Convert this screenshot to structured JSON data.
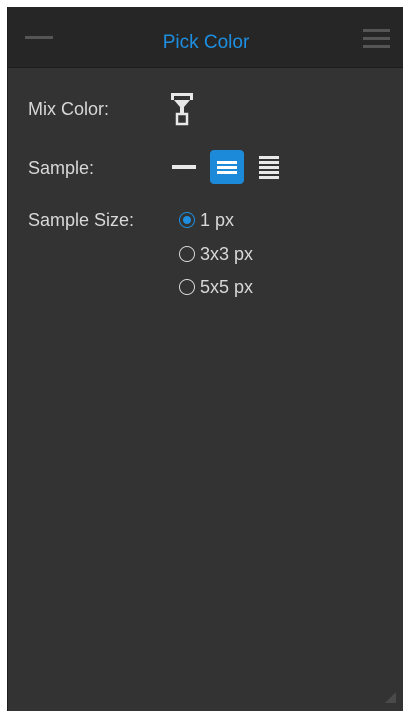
{
  "panel": {
    "title": "Pick Color",
    "minimize_icon": "minimize-dash-icon",
    "menu_icon": "hamburger-menu-icon",
    "title_color": "#1e8fe0",
    "background_color": "#333333"
  },
  "mix_color": {
    "label": "Mix Color:",
    "icon": "eyedropper-mix-icon"
  },
  "sample": {
    "label": "Sample:",
    "options": [
      {
        "icon": "single-line-icon",
        "active": false
      },
      {
        "icon": "three-lines-icon",
        "active": true
      },
      {
        "icon": "many-lines-icon",
        "active": false
      }
    ],
    "accent_color": "#1c8ad8"
  },
  "sample_size": {
    "label": "Sample Size:",
    "options": [
      {
        "label": "1 px",
        "checked": true
      },
      {
        "label": "3x3 px",
        "checked": false
      },
      {
        "label": "5x5 px",
        "checked": false
      }
    ]
  }
}
